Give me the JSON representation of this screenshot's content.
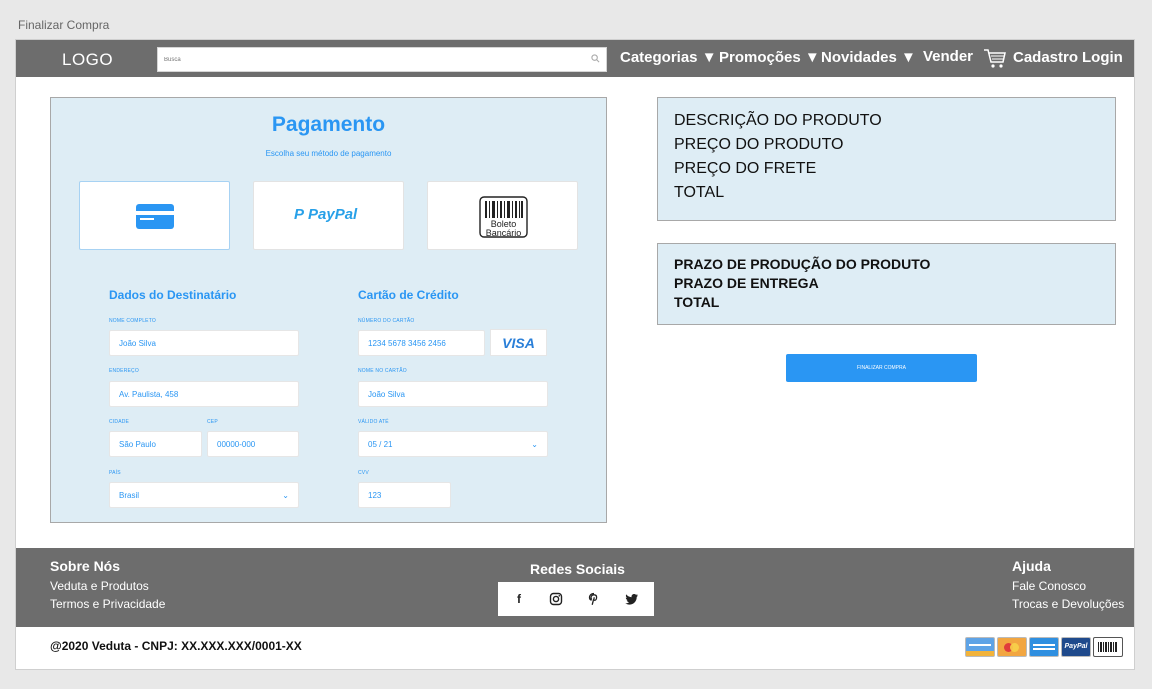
{
  "page_label": "Finalizar Compra",
  "header": {
    "logo": "LOGO",
    "search_placeholder": "Busca",
    "nav": {
      "categorias": "Categorias ▼",
      "promocoes": "Promoções ▼",
      "novidades": "Novidades ▼",
      "vender": "Vender",
      "cadastro": "Cadastro",
      "login": "Login"
    }
  },
  "payment": {
    "title": "Pagamento",
    "subtitle": "Escolha seu método de pagamento",
    "methods": {
      "card": "card-icon",
      "paypal": "PayPal",
      "boleto_line1": "Boleto",
      "boleto_line2": "Bancário"
    },
    "recipient": {
      "heading": "Dados do Destinatário",
      "name_label": "NOME COMPLETO",
      "name_value": "João Silva",
      "address_label": "ENDEREÇO",
      "address_value": "Av. Paulista, 458",
      "city_label": "CIDADE",
      "city_value": "São Paulo",
      "cep_label": "CEP",
      "cep_value": "00000-000",
      "country_label": "PAÍS",
      "country_value": "Brasil"
    },
    "card": {
      "heading": "Cartão de Crédito",
      "number_label": "NÚMERO DO CARTÃO",
      "number_value": "1234   5678   3456   2456",
      "brand": "VISA",
      "holder_label": "NOME NO CARTÃO",
      "holder_value": "João Silva",
      "valid_label": "VÁLIDO ATÉ",
      "valid_value": "05   /   21",
      "cvv_label": "CVV",
      "cvv_value": "123"
    }
  },
  "summary": {
    "description": "DESCRIÇÃO DO PRODUTO",
    "price": "PREÇO DO PRODUTO",
    "shipping": "PREÇO DO FRETE",
    "total": "TOTAL"
  },
  "deadlines": {
    "production": "PRAZO DE PRODUÇÃO DO PRODUTO",
    "delivery": "PRAZO DE ENTREGA",
    "total": "TOTAL"
  },
  "finalize_button": "FINALIZAR COMPRA",
  "footer": {
    "about_heading": "Sobre Nós",
    "about_links": [
      "Veduta e Produtos",
      "Termos e Privacidade"
    ],
    "social_heading": "Redes Sociais",
    "social_icons": [
      "facebook-icon",
      "instagram-icon",
      "pinterest-icon",
      "twitter-icon"
    ],
    "help_heading": "Ajuda",
    "help_links": [
      "Fale Conosco",
      "Trocas e Devoluções"
    ],
    "copyright": "@2020 Veduta - CNPJ: XX.XXX.XXX/0001-XX",
    "payment_icons": [
      "card-icon",
      "mastercard-icon",
      "card-icon",
      "paypal-icon",
      "barcode-icon"
    ],
    "payment_paypal_text": "PayPal"
  },
  "colors": {
    "header_bg": "#6d6d6d",
    "panel_bg": "#deedf5",
    "accent": "#2a96f3"
  }
}
